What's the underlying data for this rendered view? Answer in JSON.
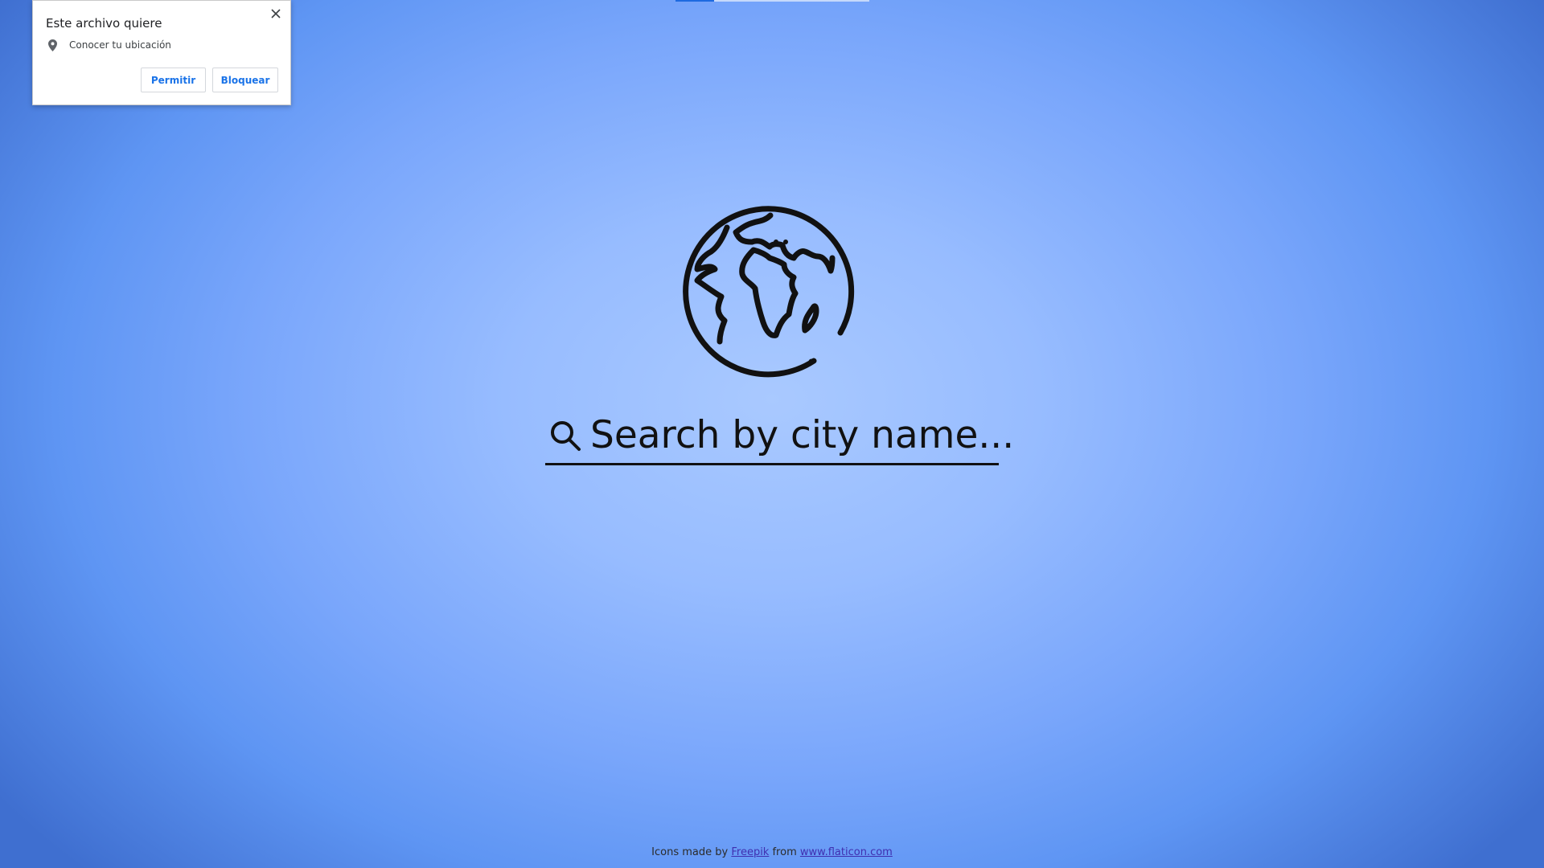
{
  "top_progress": {
    "value_percent": 20
  },
  "permission_popup": {
    "title": "Este archivo quiere",
    "request_icon": "location-pin-icon",
    "request_text": "Conocer tu ubicación",
    "allow_label": "Permitir",
    "block_label": "Bloquear",
    "accent_color": "#1a73e8"
  },
  "main": {
    "logo_icon": "globe-icon",
    "search": {
      "icon": "search-icon",
      "value": "",
      "placeholder": "Search by city name..."
    }
  },
  "footer": {
    "prefix": "Icons made by",
    "author_link": "Freepik",
    "middle": "from",
    "site_link": "www.flaticon.com"
  }
}
